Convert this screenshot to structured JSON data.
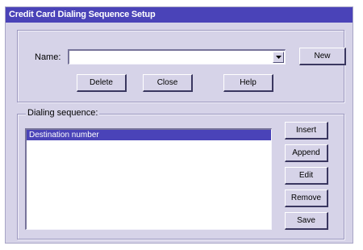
{
  "window": {
    "title": "Credit Card Dialing Sequence Setup"
  },
  "name_row": {
    "label": "Name:",
    "value": ""
  },
  "top_buttons": {
    "new": "New",
    "delete": "Delete",
    "close": "Close",
    "help": "Help"
  },
  "sequence": {
    "legend": "Dialing sequence:",
    "items": [
      {
        "label": "Destination number",
        "selected": true
      }
    ]
  },
  "side_buttons": {
    "insert": "Insert",
    "append": "Append",
    "edit": "Edit",
    "remove": "Remove",
    "save": "Save"
  },
  "colors": {
    "title_bar": "#4a43b8",
    "face": "#d6d3e8",
    "selection": "#4a43b8"
  }
}
